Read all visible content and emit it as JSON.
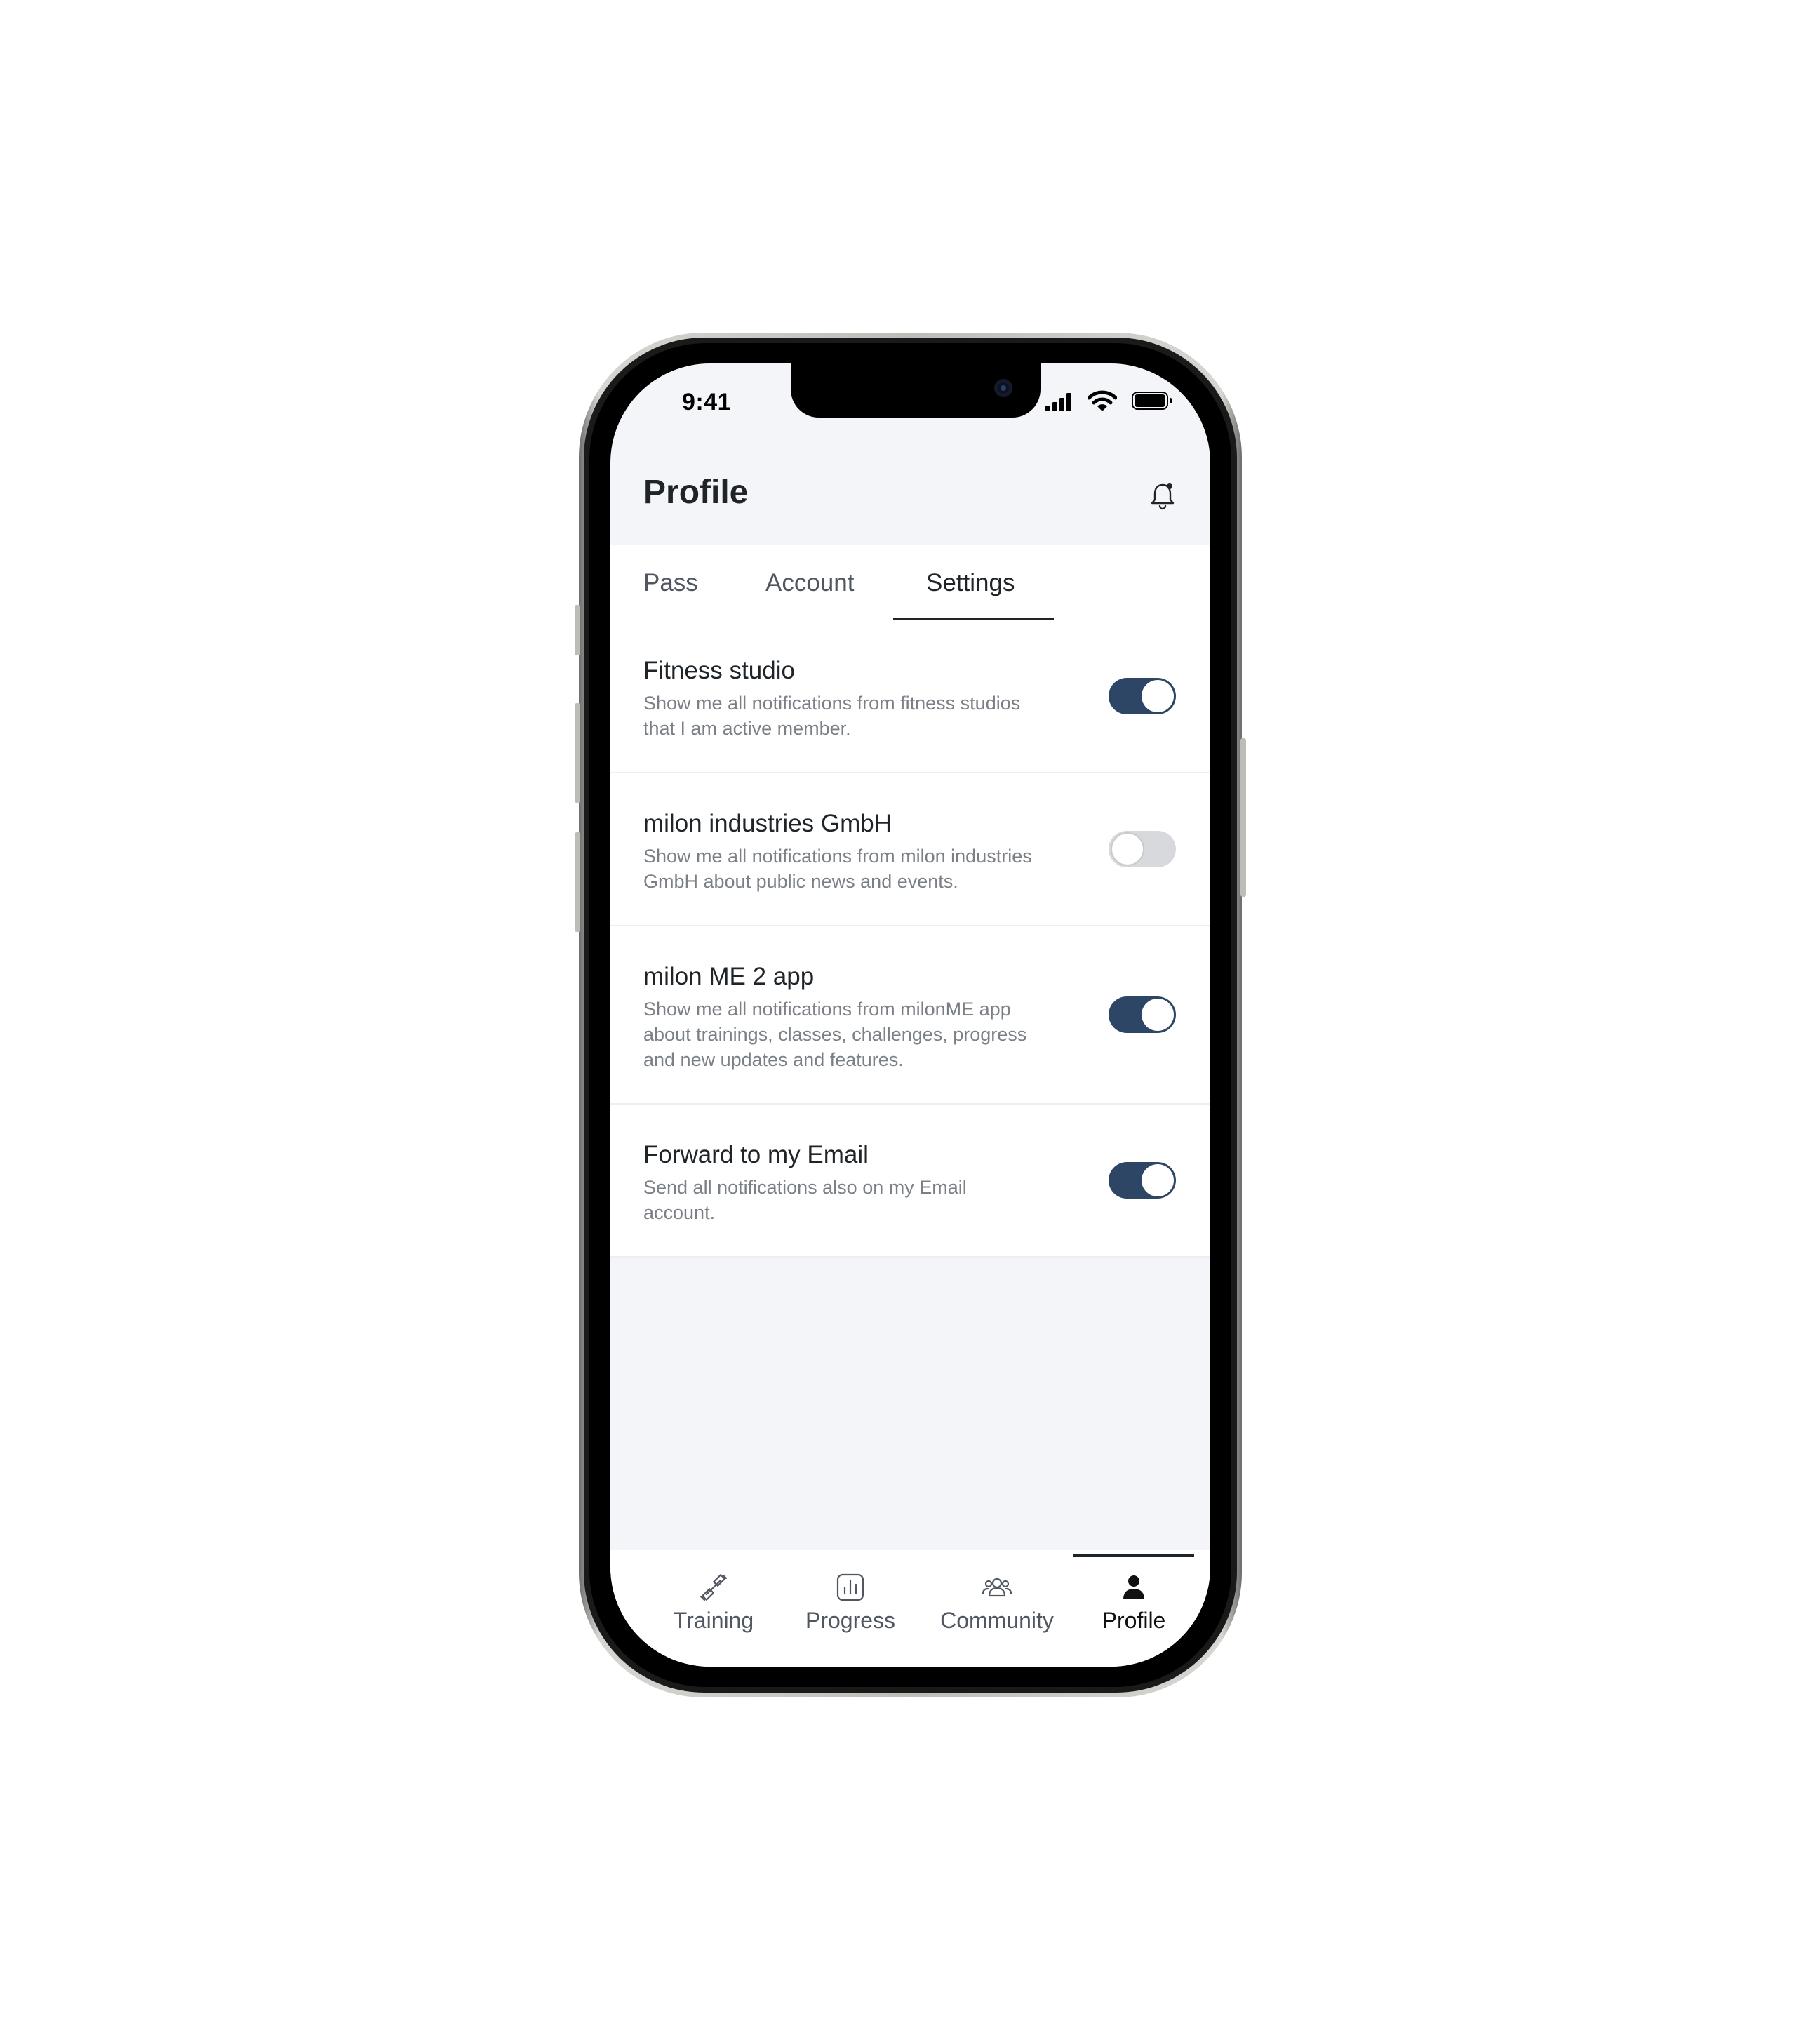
{
  "status_bar": {
    "time": "9:41"
  },
  "header": {
    "title": "Profile",
    "notification_icon": "bell-icon"
  },
  "tabs": [
    {
      "label": "Pass",
      "active": false
    },
    {
      "label": "Account",
      "active": false
    },
    {
      "label": "Settings",
      "active": true
    }
  ],
  "settings": [
    {
      "title": "Fitness studio",
      "description": "Show me all notifications from fitness studios that I am active member.",
      "enabled": true
    },
    {
      "title": "milon industries GmbH",
      "description": "Show me all notifications from milon industries GmbH about public news and events.",
      "enabled": false
    },
    {
      "title": "milon ME 2 app",
      "description": "Show me all notifications from milonME app about trainings, classes, challenges, progress and new updates and features.",
      "enabled": true
    },
    {
      "title": "Forward to my Email",
      "description": "Send all notifications also on my Email account.",
      "enabled": true
    }
  ],
  "tab_bar": [
    {
      "label": "Training",
      "icon": "dumbbell-icon",
      "active": false
    },
    {
      "label": "Progress",
      "icon": "chart-icon",
      "active": false
    },
    {
      "label": "Community",
      "icon": "people-icon",
      "active": false
    },
    {
      "label": "Profile",
      "icon": "person-icon",
      "active": true
    }
  ],
  "colors": {
    "toggle_on": "#2d4665",
    "toggle_off": "#d8d9dc",
    "background": "#f4f5f9",
    "text_primary": "#1f2429",
    "text_secondary": "#7b8087"
  }
}
